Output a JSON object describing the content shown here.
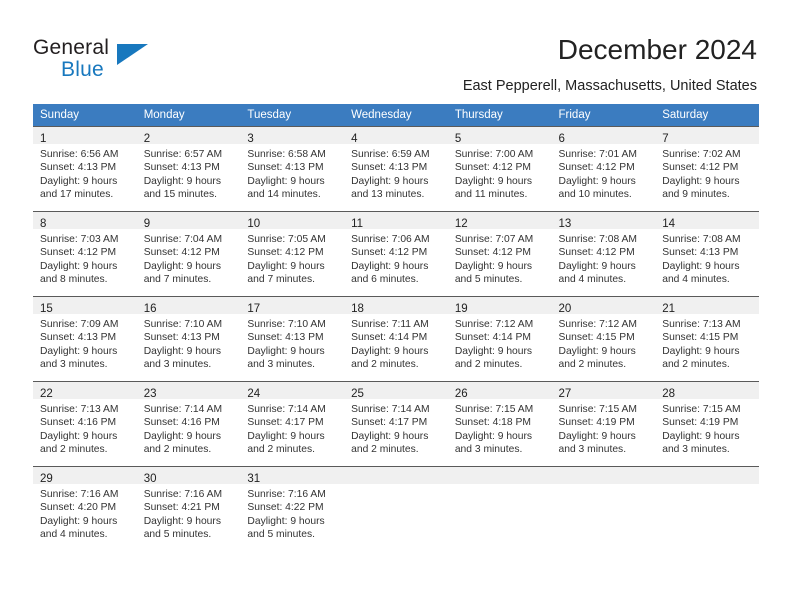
{
  "brand": {
    "name_part1": "General",
    "name_part2": "Blue",
    "accent_color": "#1878be",
    "triangle_icon": "triangle-icon"
  },
  "header": {
    "title": "December 2024",
    "subtitle": "East Pepperell, Massachusetts, United States"
  },
  "calendar": {
    "header_bg": "#3b7cc0",
    "daynum_bg": "#f0f0f0",
    "weekdays": [
      "Sunday",
      "Monday",
      "Tuesday",
      "Wednesday",
      "Thursday",
      "Friday",
      "Saturday"
    ],
    "weeks": [
      [
        {
          "day": "1",
          "sunrise": "Sunrise: 6:56 AM",
          "sunset": "Sunset: 4:13 PM",
          "daylight1": "Daylight: 9 hours",
          "daylight2": "and 17 minutes."
        },
        {
          "day": "2",
          "sunrise": "Sunrise: 6:57 AM",
          "sunset": "Sunset: 4:13 PM",
          "daylight1": "Daylight: 9 hours",
          "daylight2": "and 15 minutes."
        },
        {
          "day": "3",
          "sunrise": "Sunrise: 6:58 AM",
          "sunset": "Sunset: 4:13 PM",
          "daylight1": "Daylight: 9 hours",
          "daylight2": "and 14 minutes."
        },
        {
          "day": "4",
          "sunrise": "Sunrise: 6:59 AM",
          "sunset": "Sunset: 4:13 PM",
          "daylight1": "Daylight: 9 hours",
          "daylight2": "and 13 minutes."
        },
        {
          "day": "5",
          "sunrise": "Sunrise: 7:00 AM",
          "sunset": "Sunset: 4:12 PM",
          "daylight1": "Daylight: 9 hours",
          "daylight2": "and 11 minutes."
        },
        {
          "day": "6",
          "sunrise": "Sunrise: 7:01 AM",
          "sunset": "Sunset: 4:12 PM",
          "daylight1": "Daylight: 9 hours",
          "daylight2": "and 10 minutes."
        },
        {
          "day": "7",
          "sunrise": "Sunrise: 7:02 AM",
          "sunset": "Sunset: 4:12 PM",
          "daylight1": "Daylight: 9 hours",
          "daylight2": "and 9 minutes."
        }
      ],
      [
        {
          "day": "8",
          "sunrise": "Sunrise: 7:03 AM",
          "sunset": "Sunset: 4:12 PM",
          "daylight1": "Daylight: 9 hours",
          "daylight2": "and 8 minutes."
        },
        {
          "day": "9",
          "sunrise": "Sunrise: 7:04 AM",
          "sunset": "Sunset: 4:12 PM",
          "daylight1": "Daylight: 9 hours",
          "daylight2": "and 7 minutes."
        },
        {
          "day": "10",
          "sunrise": "Sunrise: 7:05 AM",
          "sunset": "Sunset: 4:12 PM",
          "daylight1": "Daylight: 9 hours",
          "daylight2": "and 7 minutes."
        },
        {
          "day": "11",
          "sunrise": "Sunrise: 7:06 AM",
          "sunset": "Sunset: 4:12 PM",
          "daylight1": "Daylight: 9 hours",
          "daylight2": "and 6 minutes."
        },
        {
          "day": "12",
          "sunrise": "Sunrise: 7:07 AM",
          "sunset": "Sunset: 4:12 PM",
          "daylight1": "Daylight: 9 hours",
          "daylight2": "and 5 minutes."
        },
        {
          "day": "13",
          "sunrise": "Sunrise: 7:08 AM",
          "sunset": "Sunset: 4:12 PM",
          "daylight1": "Daylight: 9 hours",
          "daylight2": "and 4 minutes."
        },
        {
          "day": "14",
          "sunrise": "Sunrise: 7:08 AM",
          "sunset": "Sunset: 4:13 PM",
          "daylight1": "Daylight: 9 hours",
          "daylight2": "and 4 minutes."
        }
      ],
      [
        {
          "day": "15",
          "sunrise": "Sunrise: 7:09 AM",
          "sunset": "Sunset: 4:13 PM",
          "daylight1": "Daylight: 9 hours",
          "daylight2": "and 3 minutes."
        },
        {
          "day": "16",
          "sunrise": "Sunrise: 7:10 AM",
          "sunset": "Sunset: 4:13 PM",
          "daylight1": "Daylight: 9 hours",
          "daylight2": "and 3 minutes."
        },
        {
          "day": "17",
          "sunrise": "Sunrise: 7:10 AM",
          "sunset": "Sunset: 4:13 PM",
          "daylight1": "Daylight: 9 hours",
          "daylight2": "and 3 minutes."
        },
        {
          "day": "18",
          "sunrise": "Sunrise: 7:11 AM",
          "sunset": "Sunset: 4:14 PM",
          "daylight1": "Daylight: 9 hours",
          "daylight2": "and 2 minutes."
        },
        {
          "day": "19",
          "sunrise": "Sunrise: 7:12 AM",
          "sunset": "Sunset: 4:14 PM",
          "daylight1": "Daylight: 9 hours",
          "daylight2": "and 2 minutes."
        },
        {
          "day": "20",
          "sunrise": "Sunrise: 7:12 AM",
          "sunset": "Sunset: 4:15 PM",
          "daylight1": "Daylight: 9 hours",
          "daylight2": "and 2 minutes."
        },
        {
          "day": "21",
          "sunrise": "Sunrise: 7:13 AM",
          "sunset": "Sunset: 4:15 PM",
          "daylight1": "Daylight: 9 hours",
          "daylight2": "and 2 minutes."
        }
      ],
      [
        {
          "day": "22",
          "sunrise": "Sunrise: 7:13 AM",
          "sunset": "Sunset: 4:16 PM",
          "daylight1": "Daylight: 9 hours",
          "daylight2": "and 2 minutes."
        },
        {
          "day": "23",
          "sunrise": "Sunrise: 7:14 AM",
          "sunset": "Sunset: 4:16 PM",
          "daylight1": "Daylight: 9 hours",
          "daylight2": "and 2 minutes."
        },
        {
          "day": "24",
          "sunrise": "Sunrise: 7:14 AM",
          "sunset": "Sunset: 4:17 PM",
          "daylight1": "Daylight: 9 hours",
          "daylight2": "and 2 minutes."
        },
        {
          "day": "25",
          "sunrise": "Sunrise: 7:14 AM",
          "sunset": "Sunset: 4:17 PM",
          "daylight1": "Daylight: 9 hours",
          "daylight2": "and 2 minutes."
        },
        {
          "day": "26",
          "sunrise": "Sunrise: 7:15 AM",
          "sunset": "Sunset: 4:18 PM",
          "daylight1": "Daylight: 9 hours",
          "daylight2": "and 3 minutes."
        },
        {
          "day": "27",
          "sunrise": "Sunrise: 7:15 AM",
          "sunset": "Sunset: 4:19 PM",
          "daylight1": "Daylight: 9 hours",
          "daylight2": "and 3 minutes."
        },
        {
          "day": "28",
          "sunrise": "Sunrise: 7:15 AM",
          "sunset": "Sunset: 4:19 PM",
          "daylight1": "Daylight: 9 hours",
          "daylight2": "and 3 minutes."
        }
      ],
      [
        {
          "day": "29",
          "sunrise": "Sunrise: 7:16 AM",
          "sunset": "Sunset: 4:20 PM",
          "daylight1": "Daylight: 9 hours",
          "daylight2": "and 4 minutes."
        },
        {
          "day": "30",
          "sunrise": "Sunrise: 7:16 AM",
          "sunset": "Sunset: 4:21 PM",
          "daylight1": "Daylight: 9 hours",
          "daylight2": "and 5 minutes."
        },
        {
          "day": "31",
          "sunrise": "Sunrise: 7:16 AM",
          "sunset": "Sunset: 4:22 PM",
          "daylight1": "Daylight: 9 hours",
          "daylight2": "and 5 minutes."
        },
        {
          "day": "",
          "sunrise": "",
          "sunset": "",
          "daylight1": "",
          "daylight2": ""
        },
        {
          "day": "",
          "sunrise": "",
          "sunset": "",
          "daylight1": "",
          "daylight2": ""
        },
        {
          "day": "",
          "sunrise": "",
          "sunset": "",
          "daylight1": "",
          "daylight2": ""
        },
        {
          "day": "",
          "sunrise": "",
          "sunset": "",
          "daylight1": "",
          "daylight2": ""
        }
      ]
    ]
  }
}
